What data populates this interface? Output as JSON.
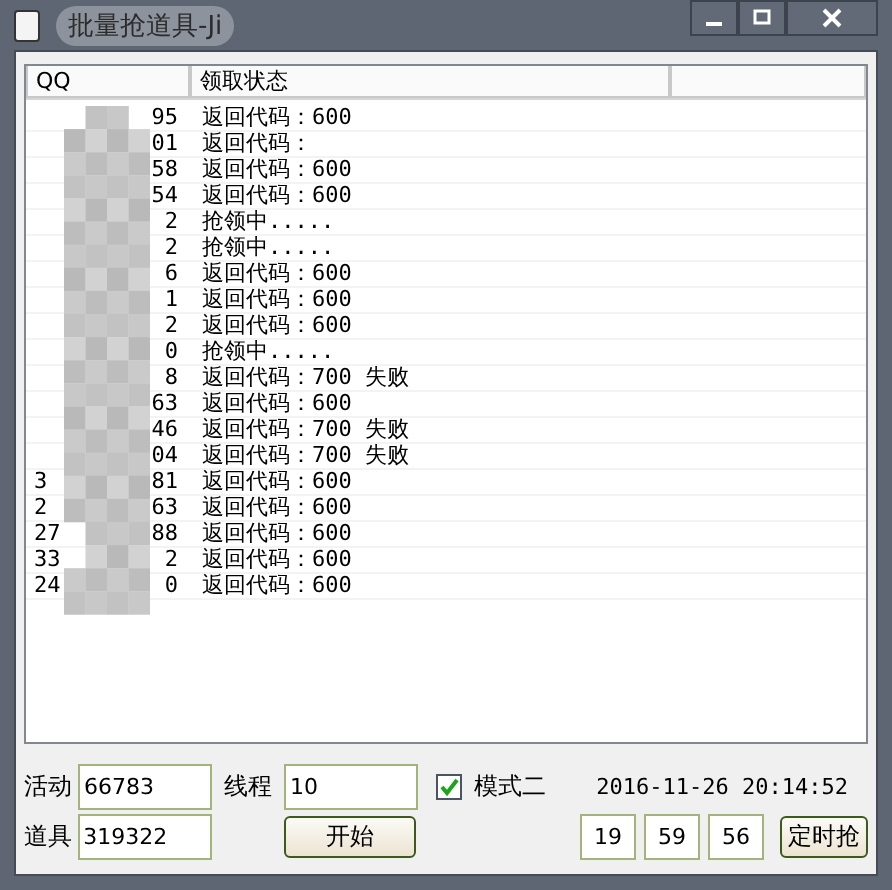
{
  "window": {
    "title": "批量抢道具-Ji"
  },
  "table": {
    "columns": [
      "QQ",
      "领取状态"
    ],
    "rows": [
      {
        "qq_start": "",
        "qq_end": "95",
        "status": "返回代码：600"
      },
      {
        "qq_start": "",
        "qq_end": "01",
        "status": "返回代码："
      },
      {
        "qq_start": "",
        "qq_end": "58",
        "status": "返回代码：600"
      },
      {
        "qq_start": "",
        "qq_end": "54",
        "status": "返回代码：600"
      },
      {
        "qq_start": "",
        "qq_end": "2",
        "status": "抢领中....."
      },
      {
        "qq_start": "",
        "qq_end": "2",
        "status": "抢领中....."
      },
      {
        "qq_start": "",
        "qq_end": "6",
        "status": "返回代码：600"
      },
      {
        "qq_start": "",
        "qq_end": "1",
        "status": "返回代码：600"
      },
      {
        "qq_start": "",
        "qq_end": "2",
        "status": "返回代码：600"
      },
      {
        "qq_start": "",
        "qq_end": "0",
        "status": "抢领中....."
      },
      {
        "qq_start": "",
        "qq_end": "8",
        "status": "返回代码：700 失败"
      },
      {
        "qq_start": "",
        "qq_end": "63",
        "status": "返回代码：600"
      },
      {
        "qq_start": "",
        "qq_end": "46",
        "status": "返回代码：700 失败"
      },
      {
        "qq_start": "",
        "qq_end": "04",
        "status": "返回代码：700 失败"
      },
      {
        "qq_start": "3",
        "qq_end": "81",
        "status": "返回代码：600"
      },
      {
        "qq_start": "2",
        "qq_end": "63",
        "status": "返回代码：600"
      },
      {
        "qq_start": "27",
        "qq_end": "88",
        "status": "返回代码：600"
      },
      {
        "qq_start": "33",
        "qq_end": "2",
        "status": "返回代码：600"
      },
      {
        "qq_start": "24",
        "qq_end": "0",
        "status": "返回代码：600"
      }
    ]
  },
  "form": {
    "activity_label": "活动",
    "activity_value": "66783",
    "item_label": "道具",
    "item_value": "319322",
    "threads_label": "线程",
    "threads_value": "10",
    "mode_label": "模式二",
    "mode_checked": true,
    "start_button": "开始",
    "datetime": "2016-11-26 20:14:52",
    "hour": "19",
    "minute": "59",
    "second": "56",
    "timer_button": "定时抢"
  }
}
